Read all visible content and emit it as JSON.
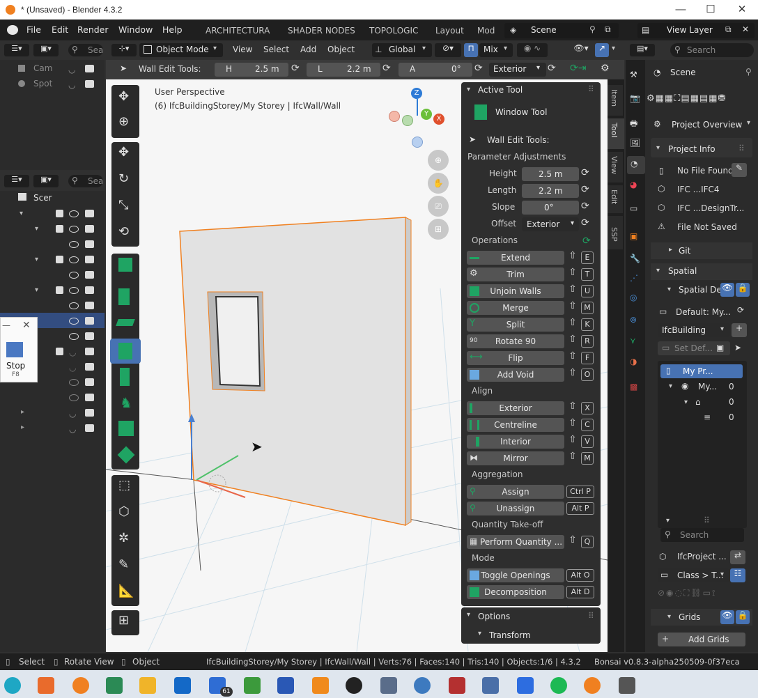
{
  "window": {
    "title": "* (Unsaved) - Blender 4.3.2"
  },
  "menu": [
    "File",
    "Edit",
    "Render",
    "Window",
    "Help"
  ],
  "workspaces": [
    "ARCHITECTURA",
    "SHADER NODES",
    "TOPOLOGIC",
    "Layout",
    "Mod"
  ],
  "scene": {
    "name": "Scene",
    "view_layer": "View Layer"
  },
  "outliner_top": {
    "search": "Sea",
    "items": [
      "Cam",
      "Spot"
    ]
  },
  "outliner_main": {
    "search": "Sea",
    "root": "Scer"
  },
  "stop_popup": {
    "label": "Stop",
    "key": "F8"
  },
  "viewport_header": {
    "mode": "Object Mode",
    "menus": [
      "View",
      "Select",
      "Add",
      "Object"
    ],
    "orientation": "Global",
    "snap": "Mix"
  },
  "tool_header": {
    "label": "Wall Edit Tools:",
    "h_label": "H",
    "h_value": "2.5 m",
    "l_label": "L",
    "l_value": "2.2 m",
    "a_label": "A",
    "a_value": "0°",
    "offset": "Exterior"
  },
  "viewport": {
    "perspective": "User Perspective",
    "context": "(6) IfcBuildingStorey/My Storey | IfcWall/Wall",
    "gizmo": {
      "z": "Z",
      "y": "Y",
      "x": "X"
    }
  },
  "side_tabs": [
    "Item",
    "Tool",
    "View",
    "Edit",
    "SSP"
  ],
  "active_tool": {
    "header": "Active Tool",
    "tool_name": "Window Tool",
    "wall_edit": "Wall Edit Tools:",
    "param_header": "Parameter Adjustments",
    "params": [
      {
        "label": "Height",
        "value": "2.5 m"
      },
      {
        "label": "Length",
        "value": "2.2 m"
      },
      {
        "label": "Slope",
        "value": "0°"
      },
      {
        "label": "Offset",
        "value": "Exterior"
      }
    ],
    "operations_header": "Operations",
    "operations": [
      {
        "label": "Extend",
        "key": "E"
      },
      {
        "label": "Trim",
        "key": "T"
      },
      {
        "label": "Unjoin Walls",
        "key": "U"
      },
      {
        "label": "Merge",
        "key": "M"
      },
      {
        "label": "Split",
        "key": "K"
      },
      {
        "label": "Rotate 90",
        "key": "R"
      },
      {
        "label": "Flip",
        "key": "F"
      },
      {
        "label": "Add Void",
        "key": "O"
      }
    ],
    "align_header": "Align",
    "align": [
      {
        "label": "Exterior",
        "key": "X"
      },
      {
        "label": "Centreline",
        "key": "C"
      },
      {
        "label": "Interior",
        "key": "V"
      },
      {
        "label": "Mirror",
        "key": "M"
      }
    ],
    "aggregation_header": "Aggregation",
    "aggregation": [
      {
        "label": "Assign",
        "key": "Ctrl P"
      },
      {
        "label": "Unassign",
        "key": "Alt P"
      }
    ],
    "qto_header": "Quantity Take-off",
    "qto": {
      "label": "Perform Quantity ...",
      "key": "Q"
    },
    "mode_header": "Mode",
    "mode": [
      {
        "label": "Toggle Openings",
        "key": "Alt O"
      },
      {
        "label": "Decomposition",
        "key": "Alt D"
      }
    ],
    "options_header": "Options",
    "transform_header": "Transform"
  },
  "properties": {
    "search": "Search",
    "scene": "Scene",
    "dropdown": "Project Overview",
    "project_info": "Project Info",
    "info_rows": [
      "No File Found",
      "IFC ...IFC4",
      "IFC ...DesignTr...",
      "File Not Saved"
    ],
    "git": "Git",
    "spatial": "Spatial",
    "spatial_dec": "Spatial Dec",
    "default": "Default: My...",
    "ifc_class": "IfcBuilding",
    "set_def": "Set Def...",
    "tree": [
      {
        "label": "My Pr...",
        "count": ""
      },
      {
        "label": "My...",
        "count": "0"
      },
      {
        "label": "",
        "count": "0"
      },
      {
        "label": "",
        "count": "0"
      }
    ],
    "tree_search": "Search",
    "ifc_project": "IfcProject ...",
    "class_dd": "Class > T...",
    "grids": "Grids",
    "add_grids": "Add Grids"
  },
  "statusbar": {
    "select": "Select",
    "rotate": "Rotate View",
    "object": "Object",
    "info": "IfcBuildingStorey/My Storey | IfcWall/Wall | Verts:76 | Faces:140 | Tris:140 | Objects:1/6 | 4.3.2",
    "version": "Bonsai v0.8.3-alpha250509-0f37eca"
  },
  "taskbar": {
    "badge": "61"
  },
  "colors": {
    "accent": "#4772b3",
    "orange": "#f08020",
    "green_op": "#1fa463"
  }
}
